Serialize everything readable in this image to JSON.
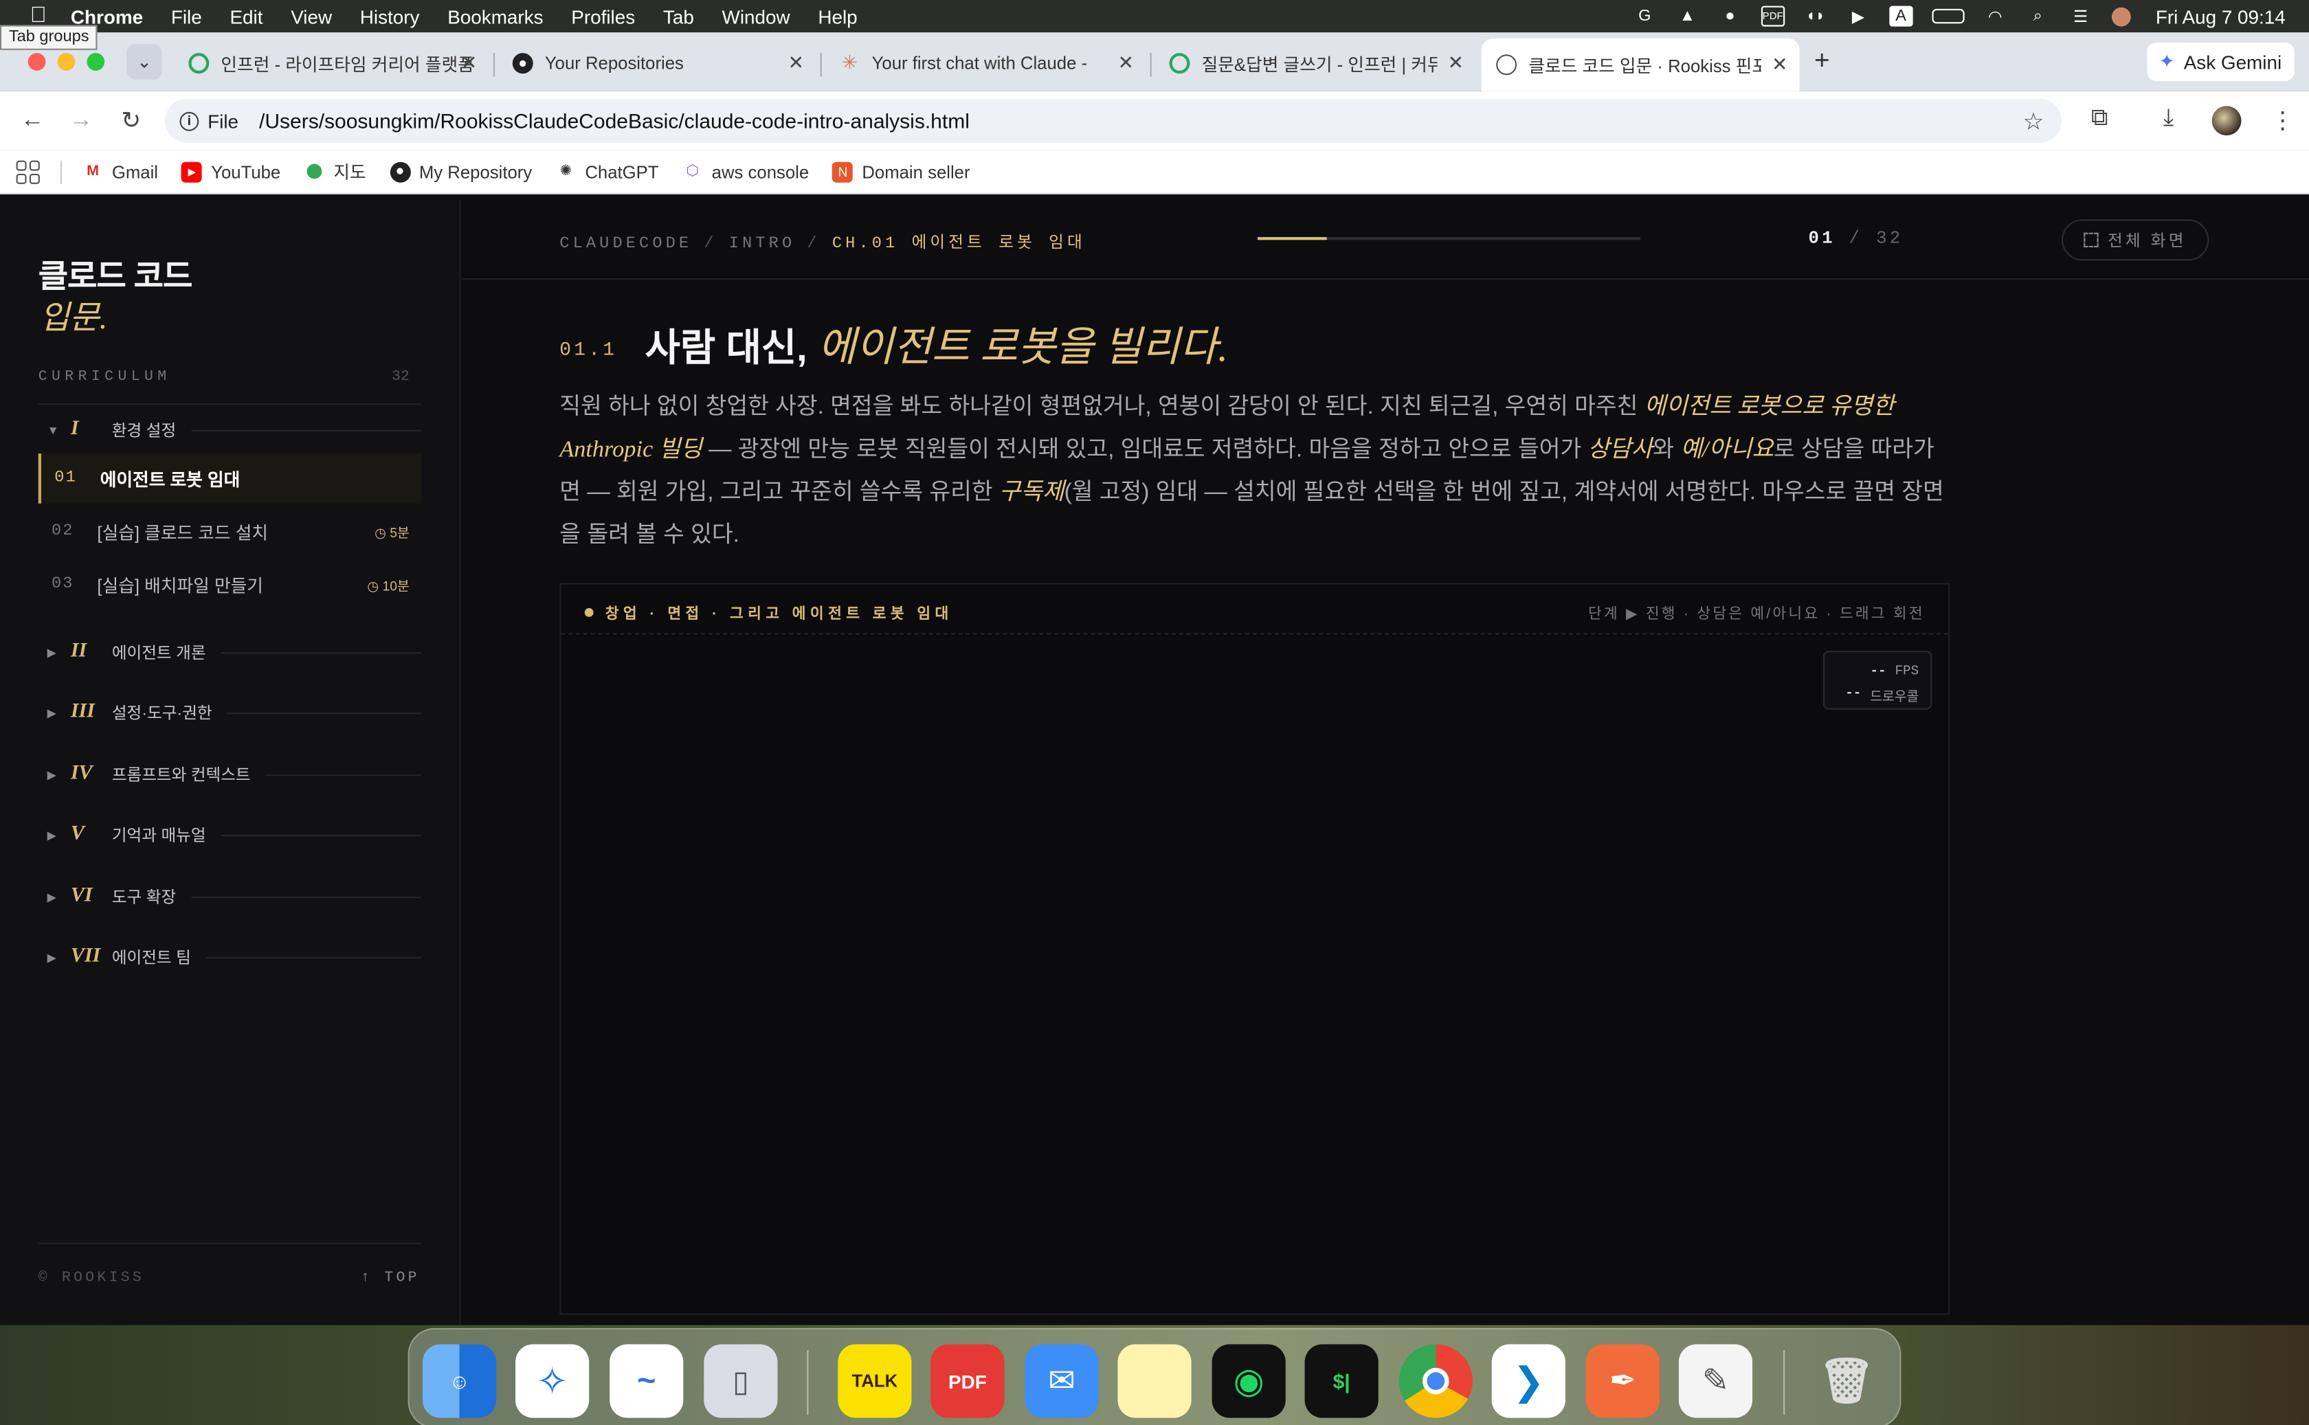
{
  "menubar": {
    "app": "Chrome",
    "items": [
      "File",
      "Edit",
      "View",
      "History",
      "Bookmarks",
      "Profiles",
      "Tab",
      "Window",
      "Help"
    ],
    "clock": "Fri Aug 7  09:14"
  },
  "tabs": {
    "tooltip": "Tab groups",
    "items": [
      {
        "title": "인프런 - 라이프타임 커리어 플랫폼"
      },
      {
        "title": "Your Repositories"
      },
      {
        "title": "Your first chat with Claude - C"
      },
      {
        "title": "질문&답변 글쓰기 - 인프런 | 커뮤니"
      },
      {
        "title": "클로드 코드 입문 · Rookiss 핀포인"
      }
    ],
    "ask_gemini": "Ask Gemini"
  },
  "omnibox": {
    "chip": "File",
    "url": "/Users/soosungkim/RookissClaudeCodeBasic/claude-code-intro-analysis.html"
  },
  "bookmarks": [
    {
      "label": "Gmail"
    },
    {
      "label": "YouTube"
    },
    {
      "label": "지도"
    },
    {
      "label": "My Repository"
    },
    {
      "label": "ChatGPT"
    },
    {
      "label": "aws console"
    },
    {
      "label": "Domain seller"
    }
  ],
  "sidebar": {
    "brand_line1": "클로드 코드",
    "brand_line2": "입문.",
    "curriculum_label": "CURRICULUM",
    "curriculum_count": "32",
    "sections": [
      {
        "roman": "I",
        "name": "환경 설정"
      },
      {
        "roman": "II",
        "name": "에이전트 개론"
      },
      {
        "roman": "III",
        "name": "설정·도구·권한"
      },
      {
        "roman": "IV",
        "name": "프롬프트와 컨텍스트"
      },
      {
        "roman": "V",
        "name": "기억과 매뉴얼"
      },
      {
        "roman": "VI",
        "name": "도구 확장"
      },
      {
        "roman": "VII",
        "name": "에이전트 팀"
      }
    ],
    "lessons": [
      {
        "num": "01",
        "title": "에이전트 로봇 임대",
        "duration": ""
      },
      {
        "num": "02",
        "title": "[실습] 클로드 코드 설치",
        "duration": "◷ 5분"
      },
      {
        "num": "03",
        "title": "[실습] 배치파일 만들기",
        "duration": "◷ 10분"
      }
    ],
    "footer_left": "© ROOKISS",
    "footer_right": "↑ TOP"
  },
  "header": {
    "crumb1": "CLAUDECODE",
    "crumb2": "INTRO",
    "crumb3": "CH.01 에이전트 로봇 임대",
    "sep": "/",
    "progress": 0.18,
    "page_current": "01",
    "page_sep": "/",
    "page_total": "32",
    "fullscreen": "전체 화면"
  },
  "content": {
    "section_num": "01.1",
    "title_plain": "사람 대신, ",
    "title_em": "에이전트 로봇을 빌리다.",
    "lead": [
      {
        "t": "직원 하나 없이 창업한 사장. 면접을 봐도 하나같이 형편없거나, 연봉이 감당이 안 된다. 지친 퇴근길, 우연히 마주친 "
      },
      {
        "t": "에이전트 로봇으로 유명한 Anthropic 빌딩",
        "hl": true
      },
      {
        "t": " — 광장엔 만능 로봇 직원들이 전시돼 있고, 임대료도 저렴하다. 마음을 정하고 안으로 들어가 "
      },
      {
        "t": "상담사",
        "hl": true
      },
      {
        "t": "와 "
      },
      {
        "t": "예/아니요",
        "hl": true
      },
      {
        "t": "로 상담을 따라가면 — 회원 가입, 그리고 꾸준히 쓸수록 유리한 "
      },
      {
        "t": "구독제",
        "hl": true
      },
      {
        "t": "(월 고정) 임대 — 설치에 필요한 선택을 한 번에 짚고, 계약서에 서명한다. 마우스로 끌면 장면을 돌려 볼 수 있다."
      }
    ]
  },
  "stage": {
    "title": "창업 · 면접 · 그리고 에이전트 로봇 임대",
    "hint": "단계 ▶ 진행 · 상담은 예/아니요 · 드래그 회전",
    "fps_value": "--",
    "fps_label": "FPS",
    "draw_value": "--",
    "draw_label": "드로우콜"
  },
  "dock": {
    "apps": [
      "finder",
      "safari",
      "freeform",
      "iphone-mirroring",
      "kakaotalk",
      "pdf-expert",
      "mail",
      "notes",
      "spotify",
      "terminal",
      "chrome",
      "vscode",
      "pen-app",
      "textedit",
      "trash"
    ],
    "kakao_label": "TALK",
    "pdf_label": "PDF",
    "terminal_label": "$|"
  }
}
